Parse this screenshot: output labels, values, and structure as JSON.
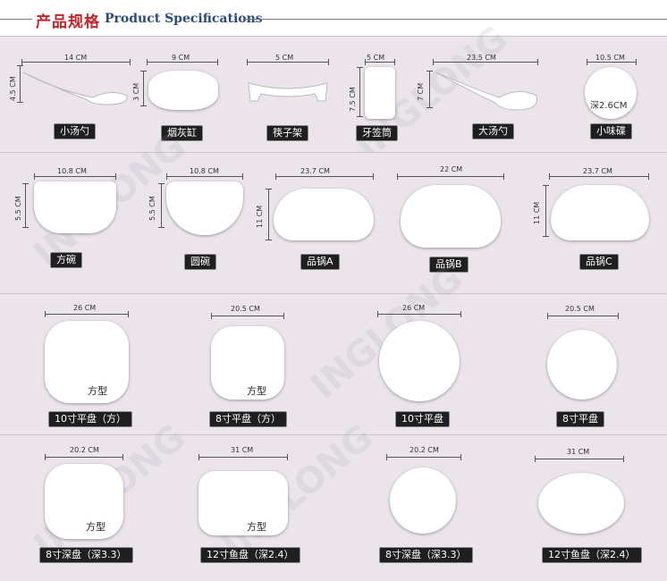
{
  "header": {
    "title_cn": "产品规格",
    "title_en": "Product Specifications"
  },
  "watermark": "INGLONG",
  "rows": [
    {
      "items": [
        {
          "name": "小汤勺",
          "dims": [
            "14 CM",
            "4.5 CM"
          ]
        },
        {
          "name": "烟灰缸",
          "dims": [
            "9 CM",
            "3 CM"
          ]
        },
        {
          "name": "筷子架",
          "dims": [
            "5 CM"
          ]
        },
        {
          "name": "牙签筒",
          "dims": [
            "5 CM",
            "7.5 CM"
          ]
        },
        {
          "name": "大汤勺",
          "dims": [
            "23.5 CM",
            "7 CM"
          ]
        },
        {
          "name": "小味碟",
          "dims": [
            "10.5 CM"
          ],
          "inner": "深2.6CM"
        }
      ]
    },
    {
      "items": [
        {
          "name": "方碗",
          "dims": [
            "10.8 CM",
            "5.5 CM"
          ]
        },
        {
          "name": "圆碗",
          "dims": [
            "10.8 CM",
            "5.5 CM"
          ]
        },
        {
          "name": "品锅A",
          "dims": [
            "23.7 CM",
            "11 CM"
          ]
        },
        {
          "name": "品锅B",
          "dims": [
            "22 CM"
          ]
        },
        {
          "name": "品锅C",
          "dims": [
            "23.7 CM",
            "11 CM"
          ]
        }
      ]
    },
    {
      "items": [
        {
          "name": "10寸平盘（方）",
          "dims": [
            "26 CM"
          ],
          "type": "方型"
        },
        {
          "name": "8寸平盘（方）",
          "dims": [
            "20.5 CM"
          ],
          "type": "方型"
        },
        {
          "name": "10寸平盘",
          "dims": [
            "26 CM"
          ]
        },
        {
          "name": "8寸平盘",
          "dims": [
            "20.5 CM"
          ]
        }
      ]
    },
    {
      "items": [
        {
          "name": "8寸深盘（深3.3）",
          "dims": [
            "20.2 CM"
          ],
          "type": "方型"
        },
        {
          "name": "12寸鱼盘（深2.4）",
          "dims": [
            "31 CM"
          ],
          "type": "方型"
        },
        {
          "name": "8寸深盘（深3.3）",
          "dims": [
            "20.2 CM"
          ]
        },
        {
          "name": "12寸鱼盘（深2.4）",
          "dims": [
            "31 CM"
          ]
        }
      ]
    }
  ]
}
